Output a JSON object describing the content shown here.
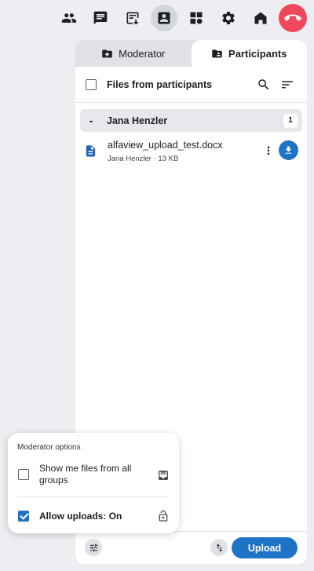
{
  "toolbar": {
    "buttons": [
      {
        "icon": "participants-icon"
      },
      {
        "icon": "chat-icon"
      },
      {
        "icon": "poll-icon"
      },
      {
        "icon": "file-transfer-icon",
        "active": true
      },
      {
        "icon": "apps-grid-icon"
      },
      {
        "icon": "gear-icon"
      },
      {
        "icon": "home-icon"
      },
      {
        "icon": "hang-up-icon",
        "color": "#f0475a"
      }
    ]
  },
  "tabs": [
    {
      "label": "Moderator",
      "icon": "folder-upload-icon",
      "selected": false
    },
    {
      "label": "Participants",
      "icon": "folder-person-icon",
      "selected": true
    }
  ],
  "files": {
    "header_label": "Files from participants",
    "groups": [
      {
        "name": "Jana Henzler",
        "count": "1",
        "items": [
          {
            "name": "alfaview_upload_test.docx",
            "meta": "Jana Henzler · 13 KB",
            "icon": "document-icon"
          }
        ]
      }
    ]
  },
  "footer": {
    "upload_label": "Upload"
  },
  "moderator_options": {
    "title": "Moderator options",
    "show_all_groups_label": "Show me files from all groups",
    "show_all_groups_checked": false,
    "allow_uploads_label": "Allow uploads: On",
    "allow_uploads_checked": true
  },
  "colors": {
    "accent": "#1f73c6",
    "hangup": "#f0475a",
    "background": "#eceef1"
  }
}
